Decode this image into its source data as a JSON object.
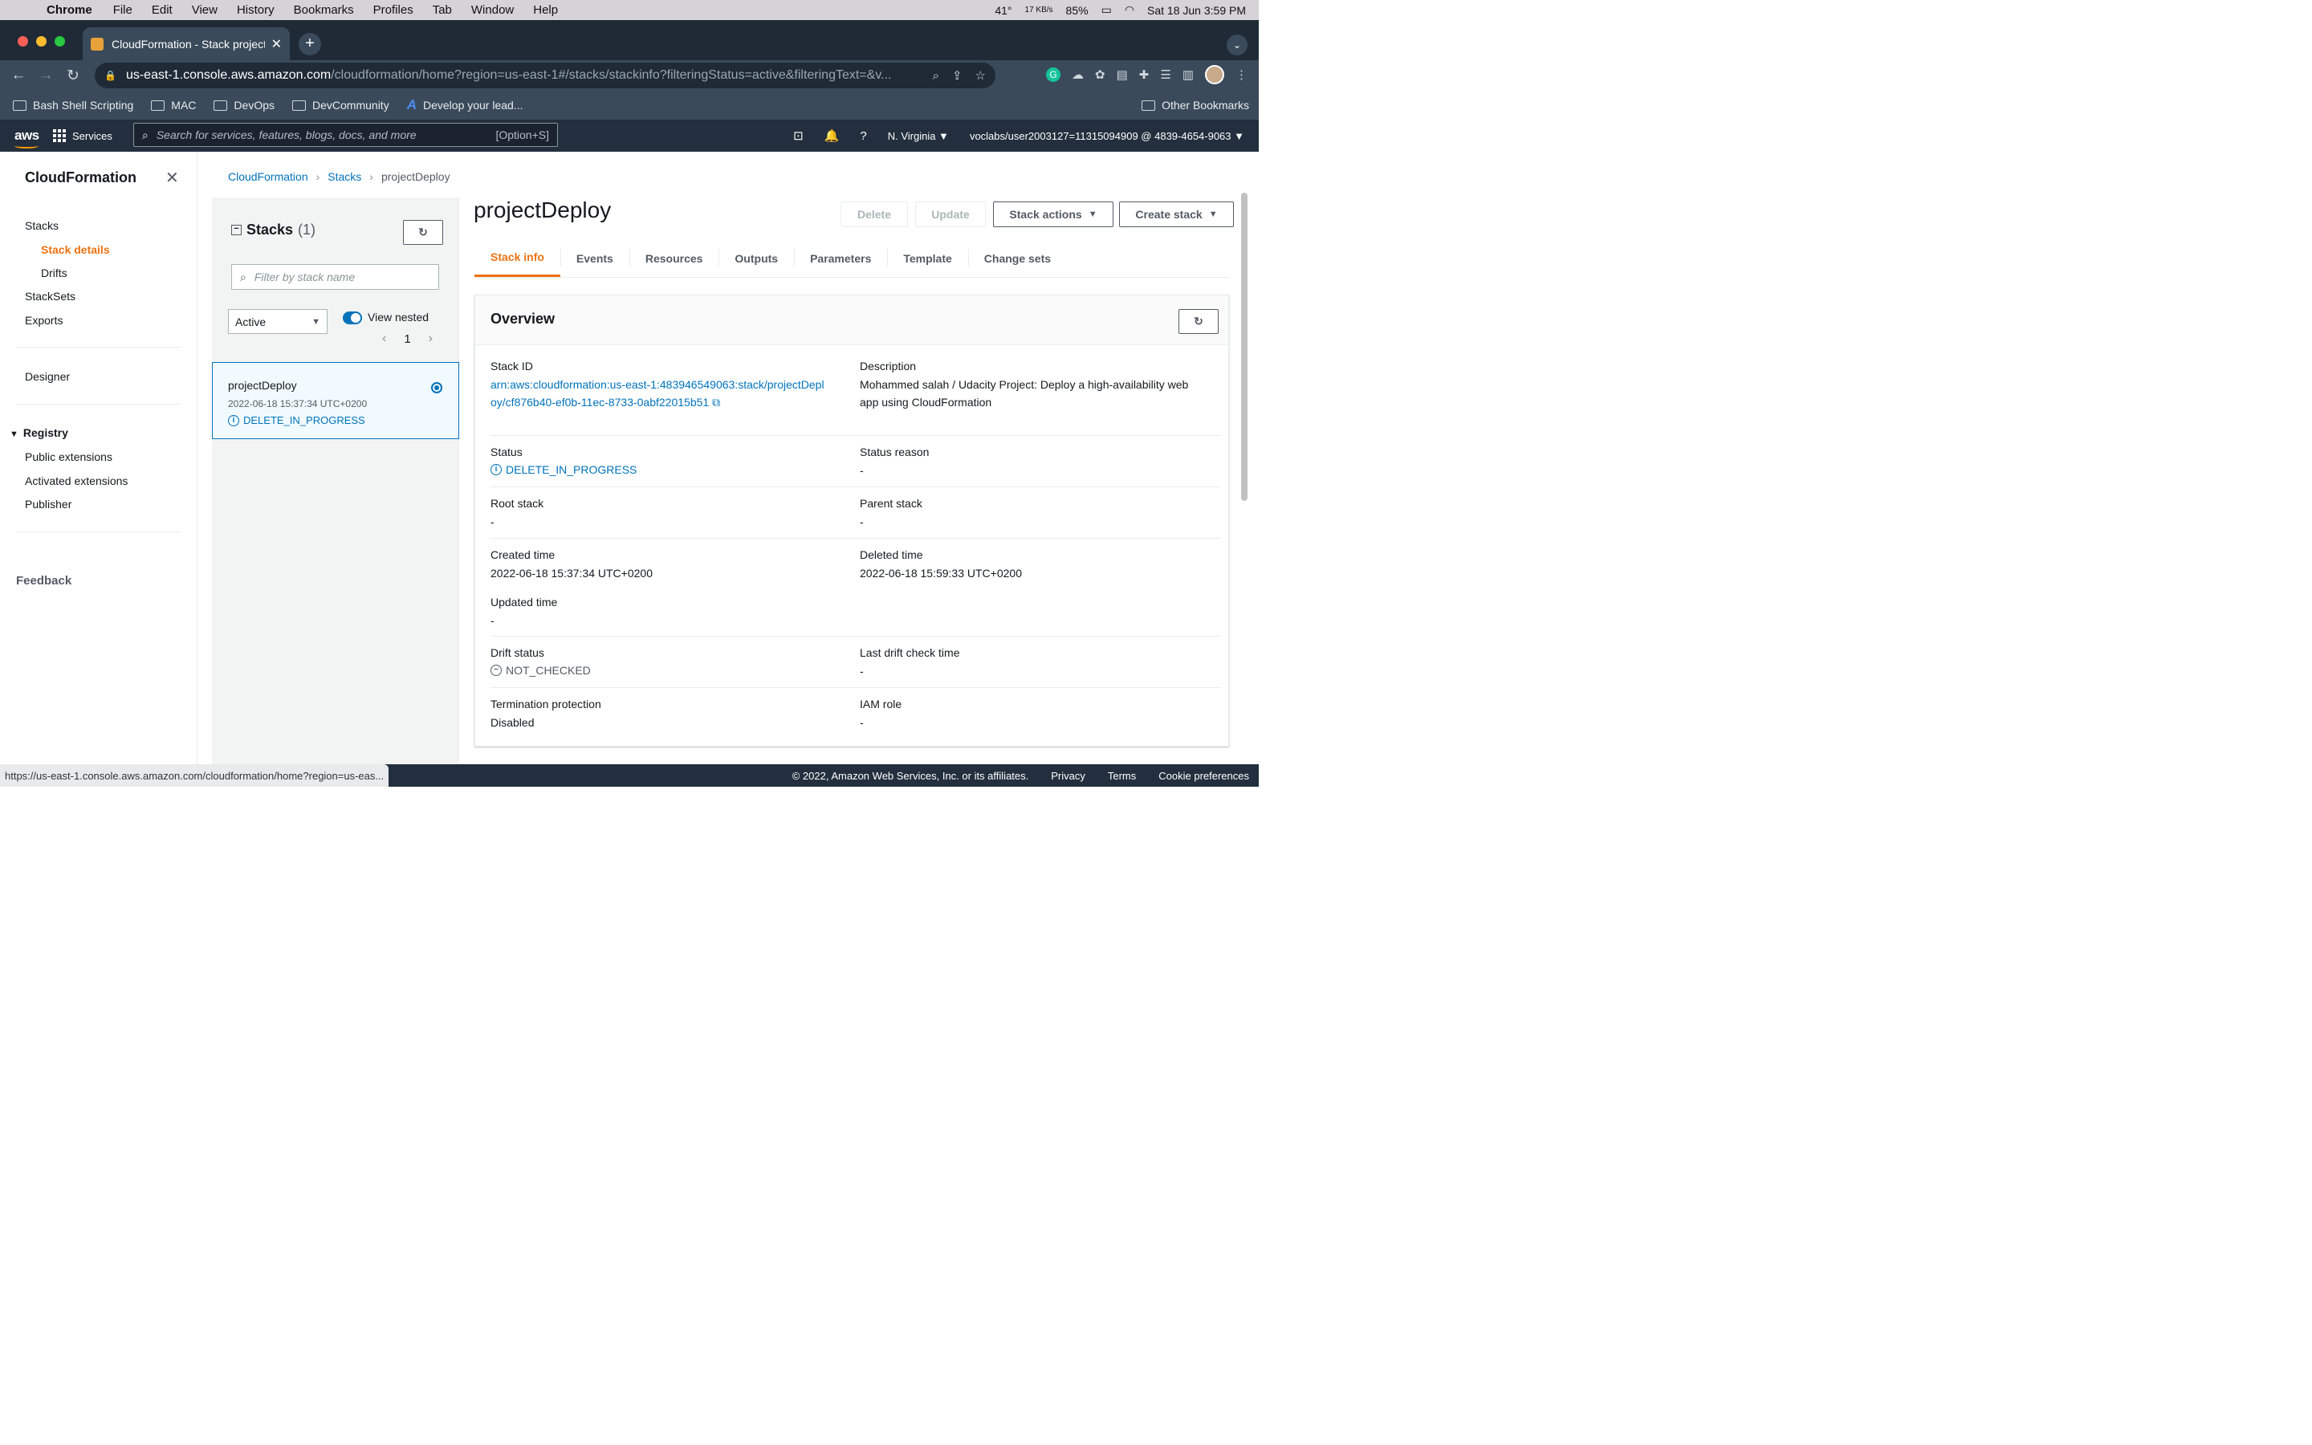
{
  "macbar": {
    "app": "Chrome",
    "menus": [
      "File",
      "Edit",
      "View",
      "History",
      "Bookmarks",
      "Profiles",
      "Tab",
      "Window",
      "Help"
    ],
    "temp": "41°",
    "net": "17 KB/s",
    "battery": "85%",
    "datetime": "Sat 18 Jun  3:59 PM"
  },
  "browser": {
    "tab_title": "CloudFormation - Stack project",
    "url_host": "us-east-1.console.aws.amazon.com",
    "url_path": "/cloudformation/home?region=us-east-1#/stacks/stackinfo?filteringStatus=active&filteringText=&v...",
    "bookmarks": [
      "Bash Shell Scripting",
      "MAC",
      "DevOps",
      "DevCommunity",
      "Develop your lead..."
    ],
    "other_bookmarks": "Other Bookmarks"
  },
  "aws": {
    "logo": "aws",
    "services": "Services",
    "search_placeholder": "Search for services, features, blogs, docs, and more",
    "search_shortcut": "[Option+S]",
    "region": "N. Virginia ▼",
    "account": "voclabs/user2003127=11315094909 @ 4839-4654-9063 ▼"
  },
  "sidebar": {
    "title": "CloudFormation",
    "stacks": "Stacks",
    "stack_details": "Stack details",
    "drifts": "Drifts",
    "stacksets": "StackSets",
    "exports": "Exports",
    "designer": "Designer",
    "registry": "Registry",
    "public_ext": "Public extensions",
    "activated_ext": "Activated extensions",
    "publisher": "Publisher",
    "feedback": "Feedback"
  },
  "breadcrumb": {
    "root": "CloudFormation",
    "stacks": "Stacks",
    "current": "projectDeploy"
  },
  "stackpanel": {
    "title": "Stacks",
    "count": "(1)",
    "filter_placeholder": "Filter by stack name",
    "status_filter": "Active",
    "view_nested": "View nested",
    "page": "1",
    "item": {
      "name": "projectDeploy",
      "date": "2022-06-18 15:37:34 UTC+0200",
      "status": "DELETE_IN_PROGRESS"
    }
  },
  "main": {
    "title": "projectDeploy",
    "buttons": {
      "delete": "Delete",
      "update": "Update",
      "stack_actions": "Stack actions",
      "create_stack": "Create stack"
    },
    "tabs": [
      "Stack info",
      "Events",
      "Resources",
      "Outputs",
      "Parameters",
      "Template",
      "Change sets"
    ],
    "overview": {
      "heading": "Overview",
      "stack_id_label": "Stack ID",
      "stack_id": "arn:aws:cloudformation:us-east-1:483946549063:stack/projectDeploy/cf876b40-ef0b-11ec-8733-0abf22015b51",
      "description_label": "Description",
      "description": "Mohammed salah / Udacity Project: Deploy a high-availability web app using CloudFormation",
      "status_label": "Status",
      "status": "DELETE_IN_PROGRESS",
      "status_reason_label": "Status reason",
      "status_reason": "-",
      "root_stack_label": "Root stack",
      "root_stack": "-",
      "parent_stack_label": "Parent stack",
      "parent_stack": "-",
      "created_label": "Created time",
      "created": "2022-06-18 15:37:34 UTC+0200",
      "deleted_label": "Deleted time",
      "deleted": "2022-06-18 15:59:33 UTC+0200",
      "updated_label": "Updated time",
      "updated": "-",
      "drift_label": "Drift status",
      "drift": "NOT_CHECKED",
      "last_drift_label": "Last drift check time",
      "last_drift": "-",
      "termination_label": "Termination protection",
      "termination": "Disabled",
      "iam_label": "IAM role",
      "iam": "-"
    }
  },
  "statusbar": {
    "hover_url": "https://us-east-1.console.aws.amazon.com/cloudformation/home?region=us-eas...",
    "copyright": "© 2022, Amazon Web Services, Inc. or its affiliates.",
    "privacy": "Privacy",
    "terms": "Terms",
    "cookies": "Cookie preferences"
  }
}
